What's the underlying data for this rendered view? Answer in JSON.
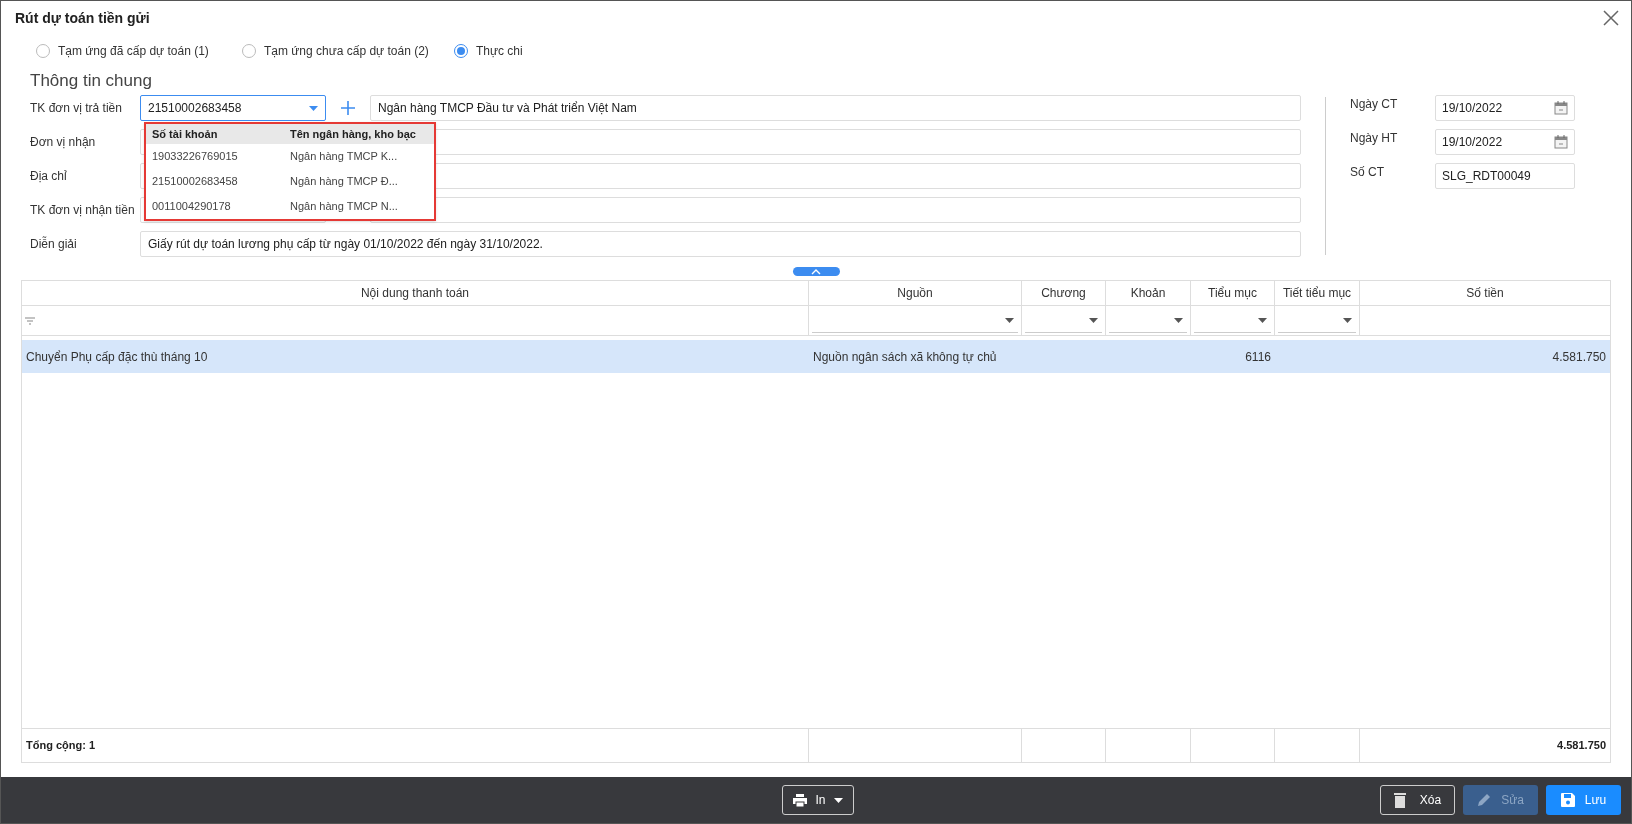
{
  "window": {
    "title": "Rút dự toán tiền gửi"
  },
  "payment_types": [
    {
      "label": "Tạm ứng đã cấp dự toán (1)",
      "selected": false
    },
    {
      "label": "Tạm ứng chưa cấp dự toán (2)",
      "selected": false
    },
    {
      "label": "Thực chi",
      "selected": true
    }
  ],
  "section_title": "Thông tin chung",
  "form_rows": [
    {
      "label": "TK đơn vị trả tiền",
      "value": "21510002683458",
      "detail": "Ngân hàng TMCP Đầu tư và Phát triển Việt Nam",
      "kind": "account"
    },
    {
      "label": "Đơn vị nhận",
      "kind": "split"
    },
    {
      "label": "Địa chỉ",
      "kind": "split"
    },
    {
      "label": "TK đơn vị nhận tiền",
      "kind": "split"
    },
    {
      "label": "Diễn giải",
      "value": "Giấy rút dự toán lương phụ cấp từ ngày 01/10/2022 đến ngày 31/10/2022.",
      "kind": "wide"
    }
  ],
  "account_dropdown": {
    "columns": [
      "Số tài khoản",
      "Tên ngân hàng, kho bạc"
    ],
    "rows": [
      {
        "account": "19033226769015",
        "bank": "Ngân hàng TMCP K..."
      },
      {
        "account": "21510002683458",
        "bank": "Ngân hàng TMCP Đ..."
      },
      {
        "account": "0011004290178",
        "bank": "Ngân hàng TMCP N..."
      }
    ]
  },
  "voucher_fields": [
    {
      "label": "Ngày CT",
      "value": "19/10/2022",
      "kind": "date"
    },
    {
      "label": "Ngày HT",
      "value": "19/10/2022",
      "kind": "date"
    },
    {
      "label": "Số CT",
      "value": "SLG_RDT00049",
      "kind": "text"
    }
  ],
  "table": {
    "columns": [
      {
        "label": "Nội dung thanh toán",
        "kind": "text"
      },
      {
        "label": "Nguồn",
        "kind": "select"
      },
      {
        "label": "Chương",
        "kind": "select"
      },
      {
        "label": "Khoản",
        "kind": "select"
      },
      {
        "label": "Tiểu mục",
        "kind": "select"
      },
      {
        "label": "Tiết tiểu mục",
        "kind": "select"
      },
      {
        "label": "Số tiền",
        "kind": "none"
      }
    ],
    "rows": [
      {
        "selected": true,
        "cells": [
          "Chuyển Phụ cấp đặc thù tháng 10",
          "Nguồn ngân sách xã không tự chủ",
          "",
          "",
          "6116",
          "",
          "4.581.750"
        ]
      }
    ],
    "total_label": "Tổng cộng: 1",
    "total_amount": "4.581.750"
  },
  "footer_buttons": [
    {
      "label": "In",
      "kind": "print",
      "disabled": false
    },
    {
      "label": "Xóa",
      "kind": "delete",
      "disabled": false
    },
    {
      "label": "Sửa",
      "kind": "edit",
      "disabled": true
    },
    {
      "label": "Lưu",
      "kind": "save",
      "disabled": false
    }
  ]
}
